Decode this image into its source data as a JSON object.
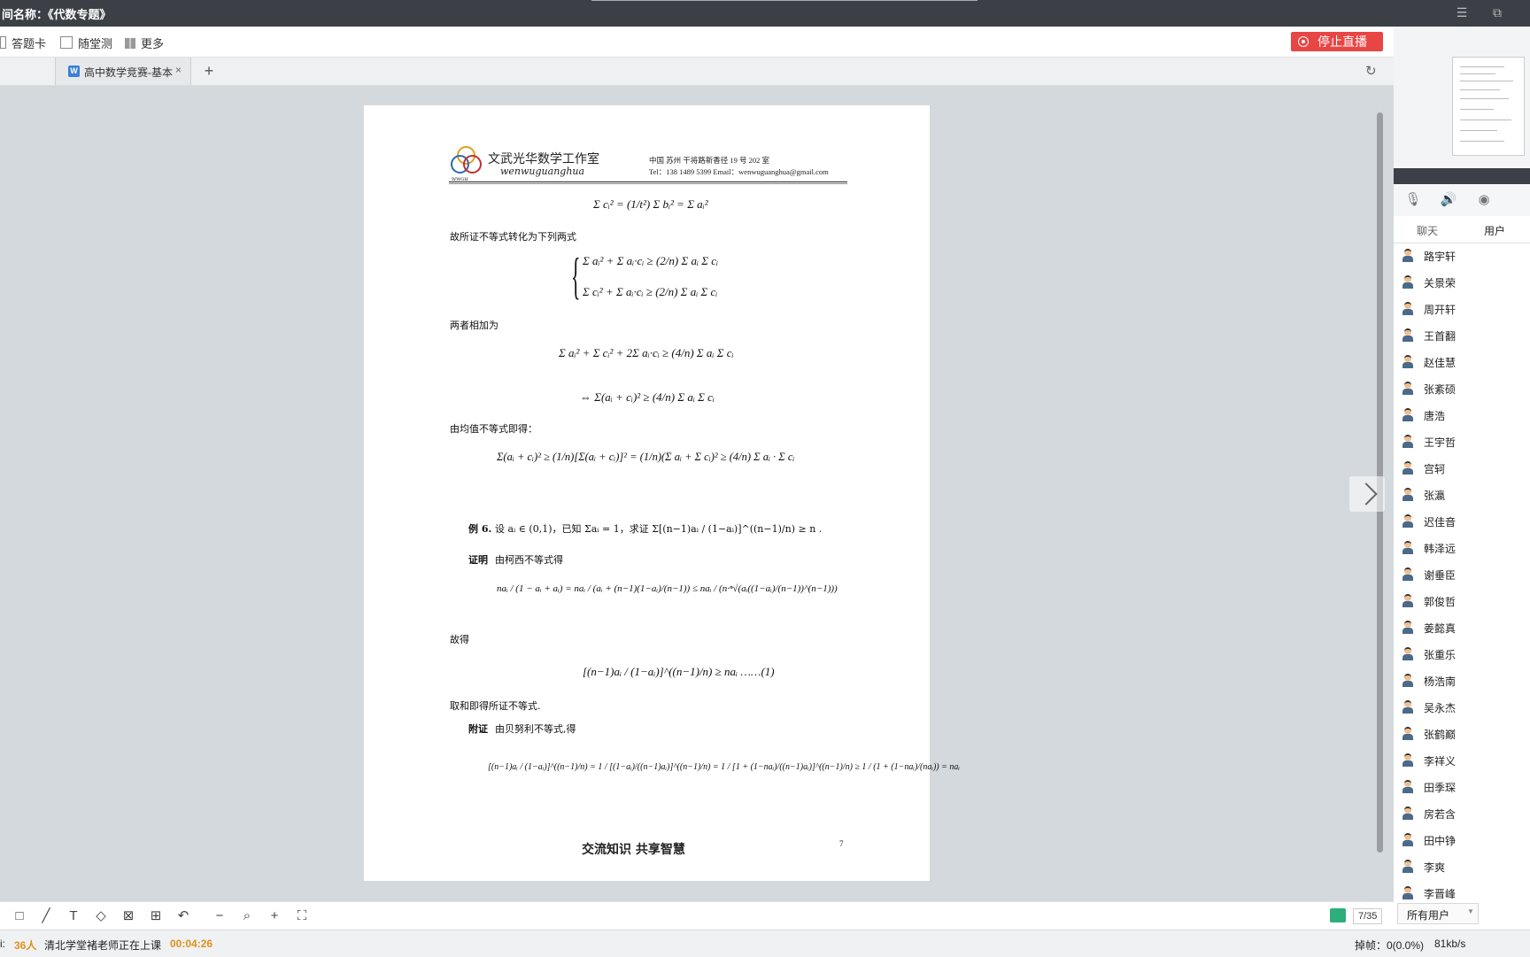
{
  "title_bar": {
    "title": "间名称：《代数专题》",
    "menu_icon": "hamburger-icon",
    "restore_icon": "restore-icon"
  },
  "toolbar": {
    "answer_card": "答题卡",
    "quiz": "随堂测",
    "more": "更多",
    "stop_live": "停止直播"
  },
  "tabs": {
    "doc_tab_label": "高中数学竞赛-基本",
    "doc_tab_icon": "W",
    "close": "×",
    "add": "+"
  },
  "document": {
    "studio_name": "文武光华数学工作室",
    "studio_pinyin": "wenwuguanghua",
    "logo_text": "WWGH",
    "address": "中国 苏州 干将路新香径 19 号 202 室",
    "contact": "Tel：138 1489 5399    Email：wenwuguanghua@gmail.com",
    "lines": {
      "l1": "故所证不等式转化为下列两式",
      "l2": "两者相加为",
      "l3": "由均值不等式即得：",
      "l4_label": "例 6.",
      "l4_text": "设 aᵢ ∈ (0,1)，已知 Σaᵢ = 1，求证 Σ[(n−1)aᵢ / (1−aᵢ)]^((n−1)/n) ≥ n .",
      "l5_label": "证明",
      "l5_text": "由柯西不等式得",
      "l6": "故得",
      "l7": "取和即得所证不等式.",
      "l8_label": "附证",
      "l8_text": "由贝努利不等式,得"
    },
    "formulas": {
      "f1": "Σ cᵢ² = (1/t²) Σ bᵢ² = Σ aᵢ²",
      "f2a": "Σ aᵢ² + Σ aᵢ·cᵢ ≥ (2/n) Σ aᵢ Σ cᵢ",
      "f2b": "Σ cᵢ² + Σ aᵢ·cᵢ ≥ (2/n) Σ aᵢ Σ cᵢ",
      "f3": "Σ aᵢ² + Σ cᵢ² + 2Σ aᵢ·cᵢ ≥ (4/n) Σ aᵢ Σ cᵢ",
      "f4": "⇔ Σ(aᵢ + cᵢ)² ≥ (4/n) Σ aᵢ Σ cᵢ",
      "f5": "Σ(aᵢ + cᵢ)² ≥ (1/n)[Σ(aᵢ + cᵢ)]² = (1/n)(Σ aᵢ + Σ cᵢ)² ≥ (4/n) Σ aᵢ · Σ cᵢ",
      "f6": "naᵢ / (1 − aᵢ + aᵢ) = naᵢ / (aᵢ + (n−1)(1−aᵢ)/(n−1)) ≤ naᵢ / (n·ⁿ√(aᵢ((1−aᵢ)/(n−1))^(n−1)))",
      "f7": "[(n−1)aᵢ / (1−aᵢ)]^((n−1)/n) ≥ naᵢ ……(1)",
      "f8": "[(n−1)aᵢ / (1−aᵢ)]^((n−1)/n) = 1 / [(1−aᵢ)/((n−1)aᵢ)]^((n−1)/n) = 1 / [1 + (1−naᵢ)/((n−1)aᵢ)]^((n−1)/n) ≥ 1 / (1 + (1−naᵢ)/(naᵢ)) = naᵢ"
    },
    "footer": "交流知识  共享智慧",
    "page_number": "7"
  },
  "bottom_tools": {
    "page_indicator": "7/35"
  },
  "status": {
    "count_prefix": "i:",
    "count": "36人",
    "message": "清北学堂褚老师正在上课",
    "timer": "00:04:26",
    "drop": "掉帧：0(0.0%)",
    "rate": "81kb/s"
  },
  "right_panel": {
    "tab_chat": "聊天",
    "tab_users": "用户",
    "users": [
      "路宇轩",
      "关景荣",
      "周开轩",
      "王首翻",
      "赵佳慧",
      "张紊硕",
      "唐浩",
      "王宇哲",
      "宫轲",
      "张瀛",
      "迟佳音",
      "韩泽远",
      "谢垂臣",
      "郭俊哲",
      "姜懿真",
      "张重乐",
      "杨浩南",
      "吴永杰",
      "张鹤巅",
      "李祥义",
      "田季琛",
      "房若含",
      "田中铮",
      "李爽",
      "李晋峰"
    ],
    "filter": "所有用户"
  },
  "colors": {
    "stop_live": "#e84545",
    "timer": "#e0901a",
    "title_bar": "#3c4046"
  }
}
